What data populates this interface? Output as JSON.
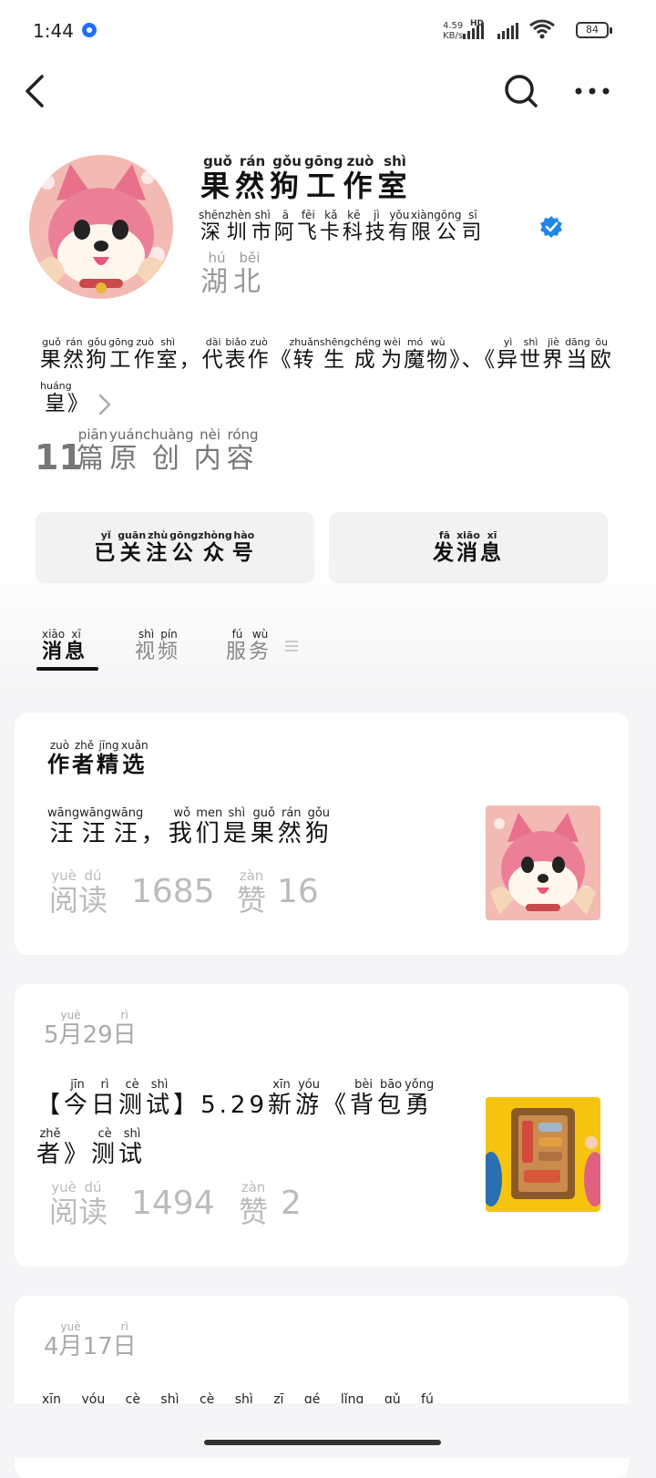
{
  "status_bar": {
    "time": "1:44",
    "network_speed": "4.59",
    "network_unit": "KB/s",
    "hd": "HD",
    "battery": "84"
  },
  "nav": {
    "back_icon": "back-chevron-icon",
    "search_icon": "search-icon",
    "more_icon": "more-dots-icon"
  },
  "profile": {
    "name": [
      [
        "果",
        "guǒ"
      ],
      [
        "然",
        "rán"
      ],
      [
        "狗",
        "gǒu"
      ],
      [
        "工",
        "gōng"
      ],
      [
        "作",
        "zuò"
      ],
      [
        "室",
        "shì"
      ]
    ],
    "company": [
      [
        "深",
        "shēn"
      ],
      [
        "圳",
        "zhèn"
      ],
      [
        "市",
        "shì"
      ],
      [
        "阿",
        "ā"
      ],
      [
        "飞",
        "fēi"
      ],
      [
        "卡",
        "kǎ"
      ],
      [
        "科",
        "kē"
      ],
      [
        "技",
        "jì"
      ],
      [
        "有",
        "yǒu"
      ],
      [
        "限",
        "xiàn"
      ],
      [
        "公",
        "gōng"
      ],
      [
        "司",
        "sī"
      ]
    ],
    "verified_color": "#1e88e5",
    "location": [
      [
        "湖",
        "hú"
      ],
      [
        "北",
        "běi"
      ]
    ],
    "intro": [
      [
        "果",
        "guǒ"
      ],
      [
        "然",
        "rán"
      ],
      [
        "狗",
        "gǒu"
      ],
      [
        "工",
        "gōng"
      ],
      [
        "作",
        "zuò"
      ],
      [
        "室",
        "shì"
      ],
      [
        "，",
        ""
      ],
      [
        "代",
        "dài"
      ],
      [
        "表",
        "biǎo"
      ],
      [
        "作",
        "zuò"
      ],
      [
        "《",
        ""
      ],
      [
        "转",
        "zhuǎn"
      ],
      [
        "生",
        "shēng"
      ],
      [
        "成",
        "chéng"
      ],
      [
        "为",
        "wèi"
      ],
      [
        "魔",
        "mó"
      ],
      [
        "物",
        "wù"
      ],
      [
        "》",
        ""
      ],
      [
        "、",
        ""
      ],
      [
        "《",
        ""
      ],
      [
        "异",
        "yì"
      ],
      [
        "世",
        "shì"
      ],
      [
        "界",
        "jiè"
      ],
      [
        "当",
        "dāng"
      ],
      [
        "欧",
        "ōu"
      ],
      [
        "皇",
        "huáng"
      ],
      [
        "》",
        ""
      ]
    ],
    "original_count": "11",
    "original_label": [
      [
        "篇",
        "piān"
      ],
      [
        "原",
        "yuán"
      ],
      [
        "创",
        "chuàng"
      ],
      [
        "内",
        "nèi"
      ],
      [
        "容",
        "róng"
      ]
    ]
  },
  "actions": {
    "followed": [
      [
        "已",
        "yǐ"
      ],
      [
        "关",
        "guān"
      ],
      [
        "注",
        "zhù"
      ],
      [
        "公",
        "gōng"
      ],
      [
        "众",
        "zhòng"
      ],
      [
        "号",
        "hào"
      ]
    ],
    "message": [
      [
        "发",
        "fā"
      ],
      [
        "消",
        "xiāo"
      ],
      [
        "息",
        "xī"
      ]
    ]
  },
  "tabs": [
    {
      "key": "messages",
      "active": true,
      "label": [
        [
          "消",
          "xiāo"
        ],
        [
          "息",
          "xī"
        ]
      ]
    },
    {
      "key": "videos",
      "active": false,
      "label": [
        [
          "视",
          "shì"
        ],
        [
          "频",
          "pín"
        ]
      ]
    },
    {
      "key": "services",
      "active": false,
      "label": [
        [
          "服",
          "fú"
        ],
        [
          "务",
          "wù"
        ]
      ]
    }
  ],
  "featured": {
    "section_title": [
      [
        "作",
        "zuò"
      ],
      [
        "者",
        "zhě"
      ],
      [
        "精",
        "jīng"
      ],
      [
        "选",
        "xuǎn"
      ]
    ],
    "article_title": [
      [
        "汪",
        "wāng"
      ],
      [
        "汪",
        "wāng"
      ],
      [
        "汪",
        "wāng"
      ],
      [
        "，",
        ""
      ],
      [
        "我",
        "wǒ"
      ],
      [
        "们",
        "men"
      ],
      [
        "是",
        "shì"
      ],
      [
        "果",
        "guǒ"
      ],
      [
        "然",
        "rán"
      ],
      [
        "狗",
        "gǒu"
      ]
    ],
    "read_label": [
      [
        "阅",
        "yuè"
      ],
      [
        "读",
        "dú"
      ]
    ],
    "reads": "1685",
    "like_label": [
      [
        "赞",
        "zàn"
      ]
    ],
    "likes": "16"
  },
  "post1": {
    "date_month": "5",
    "date_day": "29",
    "month_char": [
      [
        "月",
        "yuè"
      ]
    ],
    "day_char": [
      [
        "日",
        "rì"
      ]
    ],
    "title": [
      [
        "【",
        ""
      ],
      [
        "今",
        "jīn"
      ],
      [
        "日",
        "rì"
      ],
      [
        "测",
        "cè"
      ],
      [
        "试",
        "shì"
      ],
      [
        "】",
        ""
      ],
      [
        "5.29",
        ""
      ],
      [
        "新",
        "xīn"
      ],
      [
        "游",
        "yóu"
      ],
      [
        "《",
        ""
      ],
      [
        "背",
        "bèi"
      ],
      [
        "包",
        "bāo"
      ],
      [
        "勇",
        "yǒng"
      ],
      [
        "者",
        "zhě"
      ],
      [
        "》",
        ""
      ],
      [
        "测",
        "cè"
      ],
      [
        "试",
        "shì"
      ]
    ],
    "read_label": [
      [
        "阅",
        "yuè"
      ],
      [
        "读",
        "dú"
      ]
    ],
    "reads": "1494",
    "like_label": [
      [
        "赞",
        "zàn"
      ]
    ],
    "likes": "2"
  },
  "post2": {
    "date_month": "4",
    "date_day": "17",
    "month_char": [
      [
        "月",
        "yuè"
      ]
    ],
    "day_char": [
      [
        "日",
        "rì"
      ]
    ],
    "partial_ruby": "xīn yóu cè shì cè shì zī gé lǐng qǔ fú"
  }
}
